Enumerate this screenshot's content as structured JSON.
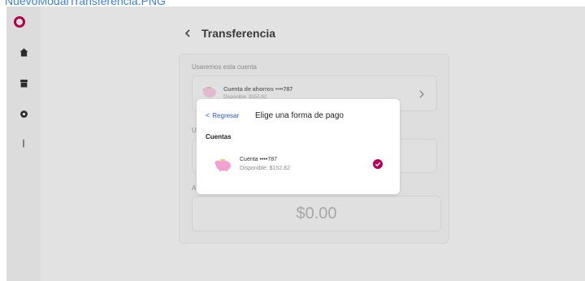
{
  "file_caption": "NuevoModalTransferencia.PNG",
  "colors": {
    "brand": "#b1004a",
    "link": "#2f55c7",
    "check": "#b5005a",
    "piggy": "#f2a2d2"
  },
  "sidebar": {
    "icons": [
      "logo-icon",
      "home-icon",
      "store-icon",
      "gear-icon",
      "dots-icon"
    ]
  },
  "header": {
    "back_glyph": "<",
    "title": "Transferencia"
  },
  "form": {
    "account_caption": "Usaremos esta cuenta",
    "account": {
      "name": "Cuenta de ahorros ••••787",
      "available": "Disponible: $152.82"
    },
    "field_label_peek": "U",
    "amount_label_peek": "A",
    "amount": "$0.00"
  },
  "modal": {
    "back_label": "Regresar",
    "title": "Elige una forma de pago",
    "section": "Cuentas",
    "option": {
      "name": "Cuenta ••••787",
      "available": "Disponible: $152.82",
      "selected": true
    }
  }
}
